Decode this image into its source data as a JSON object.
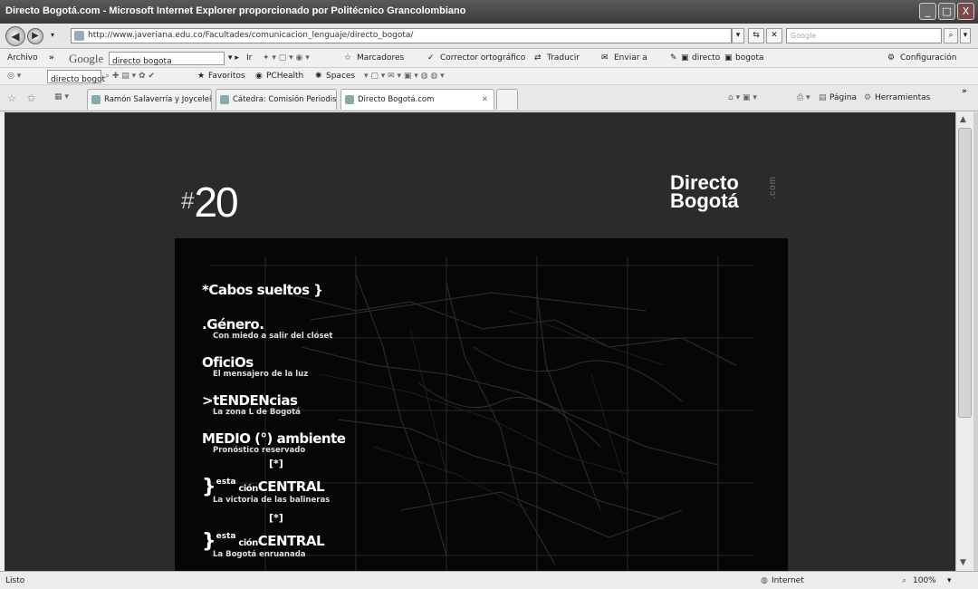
{
  "window": {
    "title": "Directo Bogotá.com - Microsoft Internet Explorer proporcionado por Politécnico Grancolombiano",
    "controls": [
      "_",
      "□",
      "X"
    ]
  },
  "address_bar": {
    "url": "http://www.javeriana.edu.co/Facultades/comunicacion_lenguaje/directo_bogota/",
    "search_placeholder": "Google"
  },
  "google_toolbar": {
    "archivo": "Archivo",
    "google_label": "Google",
    "search_value": "directo bogota",
    "ir": "Ir",
    "marcadores": "Marcadores",
    "corrector": "Corrector ortográfico",
    "traducir": "Traducir",
    "enviar": "Enviar a",
    "kw1": "directo",
    "kw2": "bogota",
    "configuracion": "Configuración"
  },
  "links_toolbar": {
    "search_value": "directo bogot",
    "favoritos": "Favoritos",
    "pchealth": "PCHealth",
    "spaces": "Spaces"
  },
  "tabs": [
    {
      "label": "Ramón Salaverría y Joyceleín ..."
    },
    {
      "label": "Cátedra: Comisión Periodism..."
    },
    {
      "label": "Directo Bogotá.com"
    }
  ],
  "command_bar": {
    "pagina": "Página",
    "herramientas": "Herramientas"
  },
  "page": {
    "issue_hash": "#",
    "issue_number": "20",
    "logo_line1": "Directo",
    "logo_line2": "Bogotá",
    "logo_com": ".com",
    "menu": {
      "cabos": "*Cabos sueltos }",
      "genero": ".Género.",
      "genero_sub": "Con miedo a salir del clóset",
      "oficios": "OficiOs",
      "oficios_sub": "El mensajero de la luz",
      "tendencias": ">tENDENcias",
      "tendencias_sub": "La zona L de Bogotá",
      "medio": "MEDIO (°) ambiente",
      "medio_sub": "Pronóstico reservado",
      "estacion1_brace": "}",
      "estacion1_esta": "esta",
      "estacion1_cion": "ción",
      "estacion1_central": "CENTRAL",
      "estacion1_bracket": "[*]",
      "estacion1_sub": "La victoria de las balineras",
      "estacion2_brace": "}",
      "estacion2_esta": "esta",
      "estacion2_cion": "ción",
      "estacion2_central": "CENTRAL",
      "estacion2_bracket": "[*]",
      "estacion2_sub": "La Bogotá enruanada"
    }
  },
  "status_bar": {
    "text": "Listo",
    "zone": "Internet",
    "zoom": "100%"
  }
}
